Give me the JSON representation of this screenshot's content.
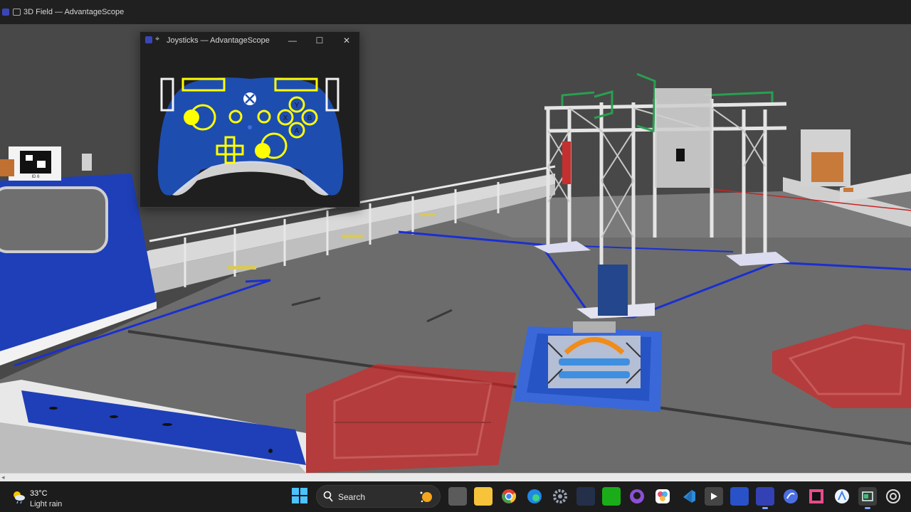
{
  "main_window": {
    "title": "3D Field — AdvantageScope"
  },
  "joystick_window": {
    "title": "Joysticks — AdvantageScope",
    "controls": {
      "minimize": "—",
      "maximize": "☐",
      "close": "✕"
    },
    "controller": {
      "face_buttons": [
        "Y",
        "X",
        "B",
        "A"
      ],
      "body_color": "#1e4db0",
      "highlight_color": "#ffff00"
    }
  },
  "field": {
    "apriltag_label": "ID 6"
  },
  "taskbar": {
    "weather": {
      "temp": "33°C",
      "condition": "Light rain"
    },
    "search": {
      "placeholder": "Search"
    },
    "icons": [
      "start-icon",
      "search-icon",
      "task-view-icon",
      "file-explorer-icon",
      "chrome-icon",
      "edge-icon",
      "settings-icon",
      "app-icon",
      "wechat-icon",
      "github-icon",
      "photos-icon",
      "vscode-icon",
      "media-player-icon",
      "app-icon-2",
      "advantagescope-icon",
      "app-icon-3",
      "jetbrains-icon",
      "app-icon-4",
      "terminal-icon",
      "chatgpt-icon"
    ]
  },
  "colors": {
    "alliance_blue": "#1f3fb8",
    "alliance_red": "#e02020",
    "carpet": "#6b6b6b",
    "taskbar": "#1c1c1c"
  }
}
